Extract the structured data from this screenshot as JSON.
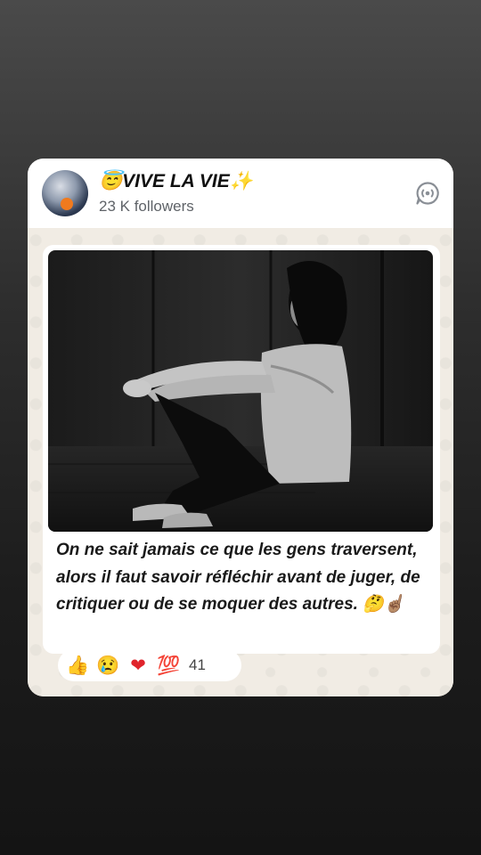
{
  "channel": {
    "name": "😇VIVE LA VIE✨",
    "followers": "23 K followers"
  },
  "post": {
    "text": "On ne sait jamais ce que les gens traversent, alors il faut savoir réfléchir avant de juger, de critiquer ou de se moquer des autres. 🤔☝🏽"
  },
  "reactions": {
    "emojis": [
      "👍",
      "😢",
      "❤",
      "💯"
    ],
    "count": "41"
  },
  "icons": {
    "header": "channel-updates-icon"
  },
  "colors": {
    "card_bg": "#f3efe8",
    "header_bg": "#ffffff",
    "text": "#1a1a1a",
    "followers": "#5f6368"
  }
}
